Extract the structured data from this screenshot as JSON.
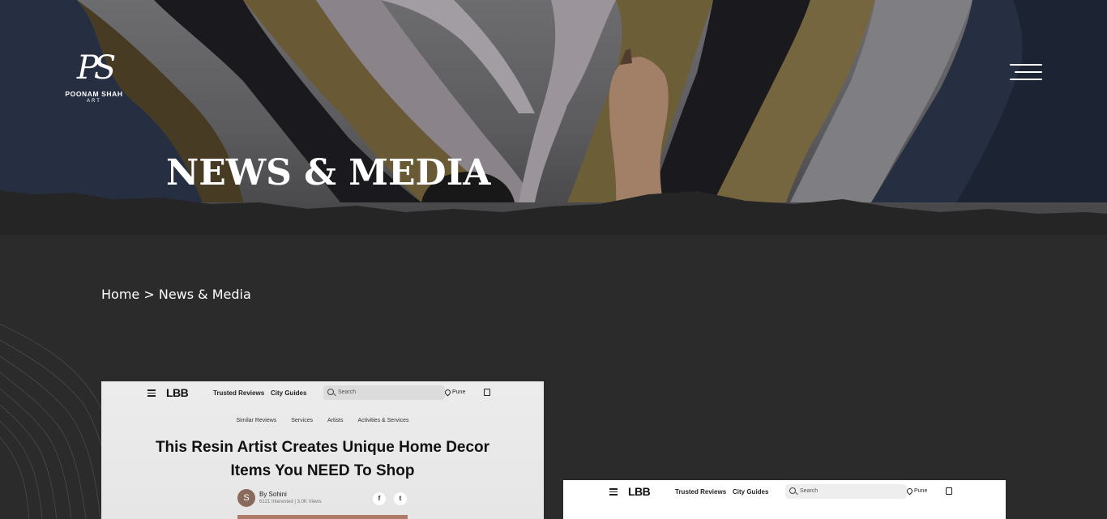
{
  "site": {
    "logo": {
      "monogram": "PS",
      "name": "POONAM SHAH",
      "sub": "ART"
    },
    "menu_icon": "hamburger-menu-icon"
  },
  "hero": {
    "title": "NEWS & MEDIA"
  },
  "breadcrumb": {
    "home": "Home",
    "separator": ">",
    "current": "News & Media"
  },
  "articles": [
    {
      "publisher": {
        "brand": "LBB",
        "nav": [
          "Trusted Reviews",
          "City Guides"
        ],
        "search_placeholder": "Search",
        "location": "Pune"
      },
      "tags": [
        "Similar Reviews",
        "Services",
        "Artists",
        "Activities & Services"
      ],
      "title": "This Resin Artist Creates Unique Home Decor Items You NEED To Shop",
      "author_initial": "S",
      "author": "By Sohini",
      "meta": "6121 Interested  |  3.0K Views",
      "share": [
        "f",
        "t"
      ]
    },
    {
      "publisher": {
        "brand": "LBB",
        "nav": [
          "Trusted Reviews",
          "City Guides"
        ],
        "search_placeholder": "Search",
        "location": "Pune"
      }
    }
  ],
  "colors": {
    "page_bg": "#2b2b2b",
    "text": "#ffffff"
  }
}
